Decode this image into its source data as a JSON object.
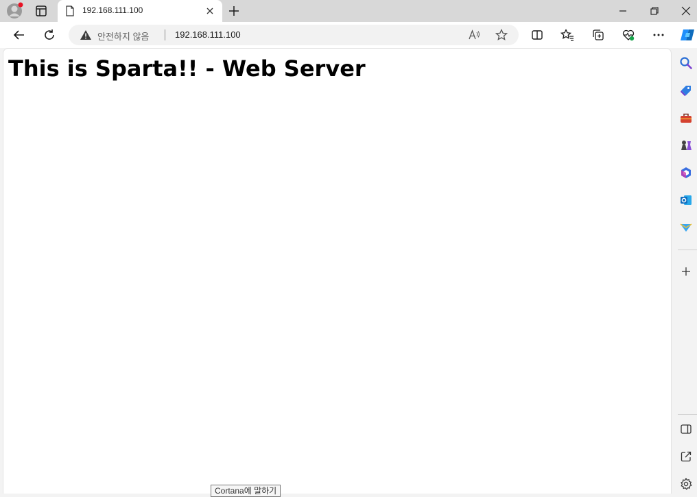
{
  "tab": {
    "title": "192.168.111.100"
  },
  "address": {
    "security_label": "안전하지 않음",
    "url": "192.168.111.100"
  },
  "page": {
    "heading": "This is Sparta!! - Web Server"
  },
  "tooltip": {
    "text": "Cortana에 말하기"
  },
  "colors": {
    "copilot": "#1f8ffb",
    "profile_dot": "#e81123"
  }
}
